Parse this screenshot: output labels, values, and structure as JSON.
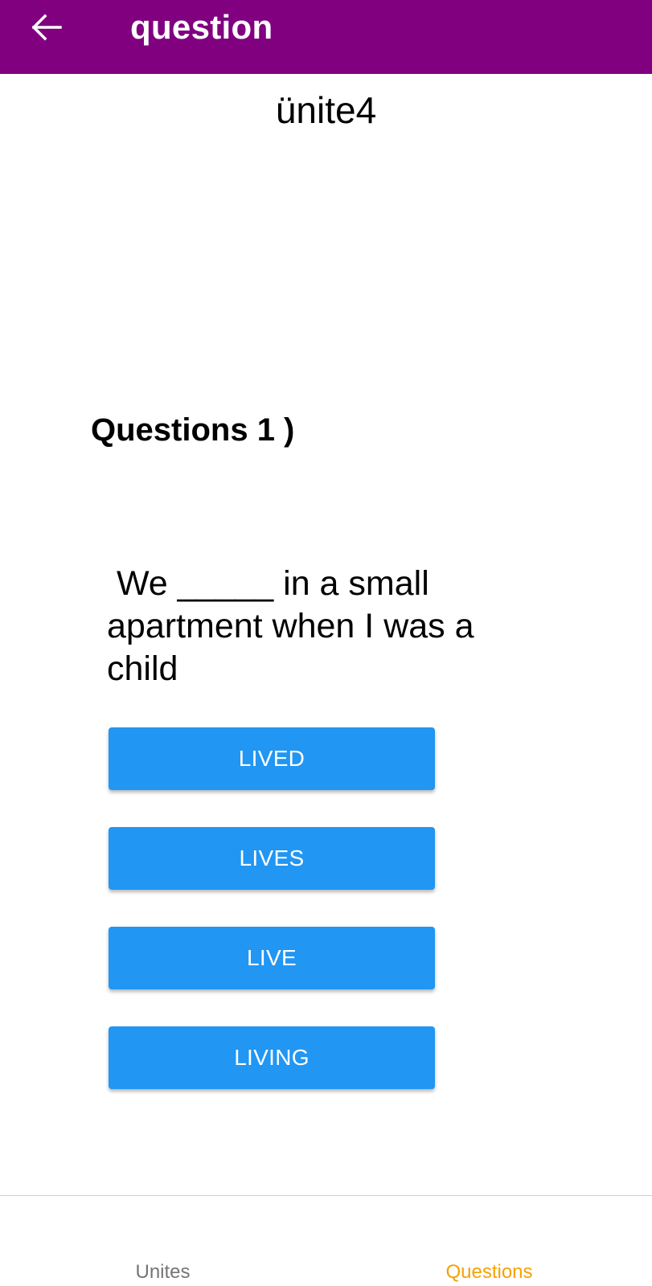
{
  "appbar": {
    "title": "question",
    "back_icon": "arrow-left-icon",
    "color": "#800080"
  },
  "unit_title": "ünite4",
  "question": {
    "heading": "Questions 1 )",
    "text": " We _____ in a small apartment when I was a child"
  },
  "options": [
    {
      "label": "LIVED"
    },
    {
      "label": "LIVES"
    },
    {
      "label": "LIVE"
    },
    {
      "label": "LIVING"
    }
  ],
  "option_color": "#2196f3",
  "bottom_nav": {
    "items": [
      {
        "label": "Unites",
        "active": false
      },
      {
        "label": "Questions",
        "active": true
      }
    ],
    "active_color": "#f4a300"
  }
}
